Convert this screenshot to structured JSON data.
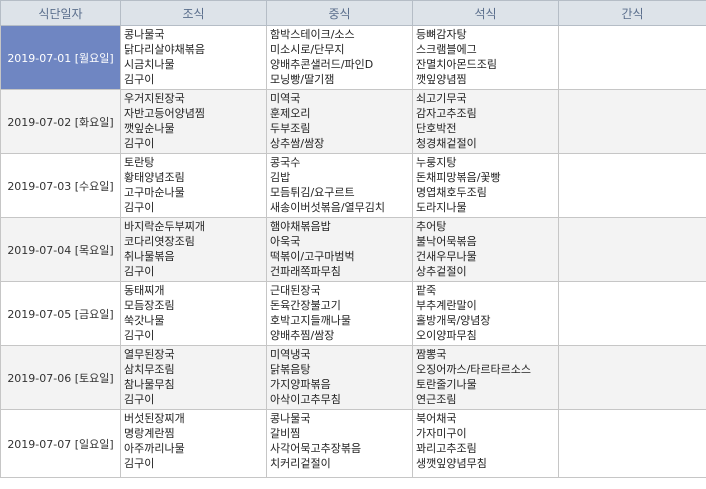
{
  "columns": [
    "식단일자",
    "조식",
    "중식",
    "석식",
    "간식"
  ],
  "rows": [
    {
      "date": "2019-07-01 [월요일]",
      "selected": true,
      "breakfast": [
        "콩나물국",
        "닭다리살야채볶음",
        "시금치나물",
        "김구이"
      ],
      "lunch": [
        "함박스테이크/소스",
        "미소시로/단무지",
        "양배추콘샐러드/파인D",
        "모닝빵/딸기잼"
      ],
      "dinner": [
        "등뼈감자탕",
        "스크램블에그",
        "잔멸치아몬드조림",
        "깻잎양념찜"
      ],
      "snack": []
    },
    {
      "date": "2019-07-02 [화요일]",
      "selected": false,
      "breakfast": [
        "우거지된장국",
        "자반고등어양념찜",
        "깻잎순나물",
        "김구이"
      ],
      "lunch": [
        "미역국",
        "훈제오리",
        "두부조림",
        "상추쌈/쌈장"
      ],
      "dinner": [
        "쇠고기무국",
        "감자고추조림",
        "단호박전",
        "청경채겉절이"
      ],
      "snack": []
    },
    {
      "date": "2019-07-03 [수요일]",
      "selected": false,
      "breakfast": [
        "토란탕",
        "황태양념조림",
        "고구마순나물",
        "김구이"
      ],
      "lunch": [
        "콩국수",
        "김밥",
        "모듬튀김/요구르트",
        "새송이버섯볶음/열무김치"
      ],
      "dinner": [
        "누룽지탕",
        "돈채피망볶음/꽃빵",
        "명엽채호두조림",
        "도라지나물"
      ],
      "snack": []
    },
    {
      "date": "2019-07-04 [목요일]",
      "selected": false,
      "breakfast": [
        "바지락순두부찌개",
        "코다리엿장조림",
        "취나물볶음",
        "김구이"
      ],
      "lunch": [
        "햄야채볶음밥",
        "아욱국",
        "떡볶이/고구마범벅",
        "건파래쪽파무침"
      ],
      "dinner": [
        "추어탕",
        "불낙어묵볶음",
        "건새우무나물",
        "상추겉절이"
      ],
      "snack": []
    },
    {
      "date": "2019-07-05 [금요일]",
      "selected": false,
      "breakfast": [
        "동태찌개",
        "모듬장조림",
        "쑥갓나물",
        "김구이"
      ],
      "lunch": [
        "근대된장국",
        "돈육간장불고기",
        "호박고지들깨나물",
        "양배추찜/쌈장"
      ],
      "dinner": [
        "팥죽",
        "부추계란말이",
        "홀방개묵/양념장",
        "오이양파무침"
      ],
      "snack": []
    },
    {
      "date": "2019-07-06 [토요일]",
      "selected": false,
      "breakfast": [
        "열무된장국",
        "삼치무조림",
        "참나물무침",
        "김구이"
      ],
      "lunch": [
        "미역냉국",
        "닭볶음탕",
        "가지양파볶음",
        "아삭이고추무침"
      ],
      "dinner": [
        "짬뽕국",
        "오징어까스/타르타르소스",
        "토란줄기나물",
        "연근조림"
      ],
      "snack": []
    },
    {
      "date": "2019-07-07 [일요일]",
      "selected": false,
      "breakfast": [
        "버섯된장찌개",
        "명랑계란찜",
        "아주까리나물",
        "김구이"
      ],
      "lunch": [
        "콩나물국",
        "갈비찜",
        "사각어묵고추장볶음",
        "치커리겉절이"
      ],
      "dinner": [
        "북어채국",
        "가자미구이",
        "꽈리고추조림",
        "생깻잎양념무침"
      ],
      "snack": []
    }
  ],
  "colors": {
    "header_bg": "#dde3e9",
    "header_text": "#5a6e8c",
    "selected_bg": "#6f86c2",
    "shaded_row_bg": "#f3f3f3"
  }
}
